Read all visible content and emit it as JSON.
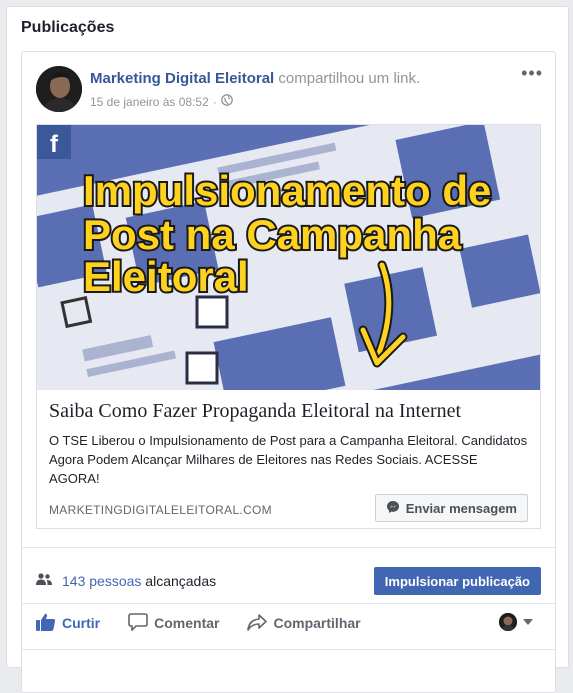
{
  "panel": {
    "title": "Publicações"
  },
  "post": {
    "author": "Marketing Digital Eleitoral",
    "action": "compartilhou um link.",
    "date": "15 de janeiro às 08:52",
    "privacy_icon": "globe-icon",
    "more_icon": "more-icon",
    "link": {
      "image_text": [
        "Impulsionamento de",
        "Post na Campanha",
        "Eleitoral"
      ],
      "image_badge": "f",
      "title": "Saiba Como Fazer Propaganda Eleitoral na Internet",
      "description": "O TSE Liberou o Impulsionamento de Post para a Campanha Eleitoral. Candidatos Agora Podem Alcançar Milhares de Eleitores nas Redes Sociais. ACESSE AGORA!",
      "domain": "MARKETINGDIGITALELEITORAL.COM",
      "message_button": "Enviar mensagem"
    },
    "reach": {
      "count": "143 pessoas",
      "suffix": "alcançadas",
      "boost_button": "Impulsionar publicação"
    },
    "actions": {
      "like": "Curtir",
      "comment": "Comentar",
      "share": "Compartilhar"
    }
  },
  "colors": {
    "link_blue": "#365899",
    "accent": "#4267b2",
    "image_bg": "#5a6fb3",
    "image_text_fill": "#ffd21f"
  }
}
